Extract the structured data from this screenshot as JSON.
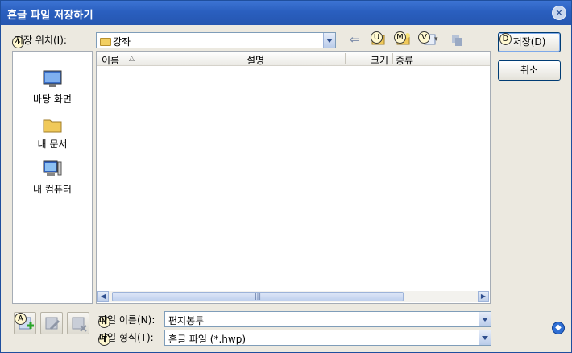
{
  "window": {
    "title": "흔글 파일 저장하기"
  },
  "location": {
    "label": "저장 위치(I):",
    "hotkey": "I",
    "value": "강좌"
  },
  "toolbar": {
    "back_arrow": "⇐",
    "up_hotkey": "U",
    "newfolder_hotkey": "M",
    "view_hotkey": "V",
    "view_caret": "▾"
  },
  "places": [
    {
      "label": "바탕 화면",
      "icon": "desktop-icon"
    },
    {
      "label": "내 문서",
      "icon": "folder-icon"
    },
    {
      "label": "내 컴퓨터",
      "icon": "computer-icon"
    }
  ],
  "list": {
    "columns": [
      "이름",
      "설명",
      "크기",
      "종류"
    ],
    "sort_indicator": "△",
    "scroll_left": "◀",
    "scroll_right": "▶",
    "scroll_thumb_grip": "|||"
  },
  "filename": {
    "label": "파일 이름(N):",
    "hotkey": "N",
    "value": "편지봉투"
  },
  "filetype": {
    "label": "파일 형식(T):",
    "hotkey": "T",
    "value": "흔글 파일 (*.hwp)"
  },
  "buttons": {
    "save": "저장(D)",
    "save_hotkey": "D",
    "cancel": "취소"
  },
  "bottom_tools": {
    "a_hotkey": "A"
  },
  "colors": {
    "title_bar": "#2a5fbf",
    "dialog_bg": "#ece9e0",
    "border": "#7f9db9"
  }
}
